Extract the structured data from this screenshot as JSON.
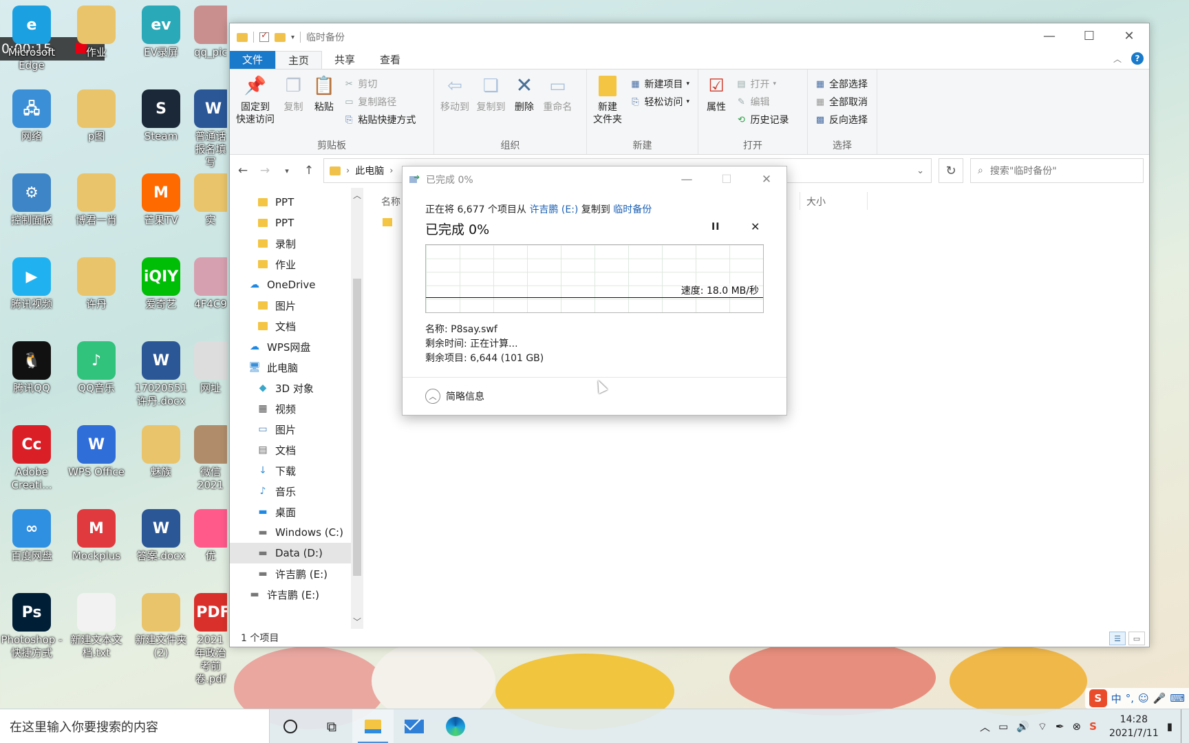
{
  "recorder": {
    "timer": "0:00:15"
  },
  "desktop": {
    "icons": [
      {
        "label": "Microsoft Edge",
        "icon": "edge-icon",
        "color": "#1ba1e2",
        "glyph": "e"
      },
      {
        "label": "作业",
        "icon": "folder-icon",
        "color": "#e9c46a",
        "glyph": ""
      },
      {
        "label": "EV录屏",
        "icon": "ev-recorder-icon",
        "color": "#2aa9b8",
        "glyph": "ev"
      },
      {
        "label": "qq_pic",
        "icon": "image-icon",
        "color": "#c98e8e",
        "glyph": ""
      },
      {
        "label": "网络",
        "icon": "network-icon",
        "color": "#3b8fd6",
        "glyph": "🖧"
      },
      {
        "label": "p图",
        "icon": "folder-icon",
        "color": "#e9c46a",
        "glyph": ""
      },
      {
        "label": "Steam",
        "icon": "steam-icon",
        "color": "#1b2838",
        "glyph": "S"
      },
      {
        "label": "普通话报名填写",
        "icon": "word-doc-icon",
        "color": "#2b5797",
        "glyph": "W"
      },
      {
        "label": "控制面板",
        "icon": "control-panel-icon",
        "color": "#3d85c6",
        "glyph": "⚙"
      },
      {
        "label": "博君一肖",
        "icon": "folder-icon",
        "color": "#e9c46a",
        "glyph": ""
      },
      {
        "label": "芒果TV",
        "icon": "mango-tv-icon",
        "color": "#ff6a00",
        "glyph": "M"
      },
      {
        "label": "实",
        "icon": "folder-icon",
        "color": "#e9c46a",
        "glyph": ""
      },
      {
        "label": "腾讯视频",
        "icon": "tencent-video-icon",
        "color": "#20b2f0",
        "glyph": "▶"
      },
      {
        "label": "许丹",
        "icon": "folder-icon",
        "color": "#e9c46a",
        "glyph": ""
      },
      {
        "label": "爱奇艺",
        "icon": "iqiyi-icon",
        "color": "#00be06",
        "glyph": "iQIY"
      },
      {
        "label": "4F4C9",
        "icon": "image-icon",
        "color": "#d7a0b0",
        "glyph": ""
      },
      {
        "label": "腾讯QQ",
        "icon": "qq-icon",
        "color": "#111111",
        "glyph": "🐧"
      },
      {
        "label": "QQ音乐",
        "icon": "qq-music-icon",
        "color": "#31c27c",
        "glyph": "♪"
      },
      {
        "label": "17020551 许丹.docx",
        "icon": "word-doc-icon",
        "color": "#2b5797",
        "glyph": "W"
      },
      {
        "label": "网址",
        "icon": "document-icon",
        "color": "#dddddd",
        "glyph": ""
      },
      {
        "label": "Adobe Creati...",
        "icon": "adobe-cc-icon",
        "color": "#da1f26",
        "glyph": "Cc"
      },
      {
        "label": "WPS Office",
        "icon": "wps-office-icon",
        "color": "#2f6dd9",
        "glyph": "W"
      },
      {
        "label": "魅族",
        "icon": "folder-icon",
        "color": "#e9c46a",
        "glyph": ""
      },
      {
        "label": "微信 2021",
        "icon": "image-icon",
        "color": "#b08c6a",
        "glyph": ""
      },
      {
        "label": "百度网盘",
        "icon": "baidu-netdisk-icon",
        "color": "#2f8fe0",
        "glyph": "∞"
      },
      {
        "label": "Mockplus",
        "icon": "mockplus-icon",
        "color": "#e0393e",
        "glyph": "M"
      },
      {
        "label": "答案.docx",
        "icon": "word-doc-icon",
        "color": "#2b5797",
        "glyph": "W"
      },
      {
        "label": "优",
        "icon": "app-icon",
        "color": "#ff5a8a",
        "glyph": ""
      },
      {
        "label": "Photoshop - 快捷方式",
        "icon": "photoshop-icon",
        "color": "#001e36",
        "glyph": "Ps"
      },
      {
        "label": "新建文本文档.txt",
        "icon": "text-file-icon",
        "color": "#f2f2f2",
        "glyph": ""
      },
      {
        "label": "新建文件夹 (2)",
        "icon": "folder-icon",
        "color": "#e9c46a",
        "glyph": ""
      },
      {
        "label": "2021年政治 考前卷.pdf",
        "icon": "pdf-icon",
        "color": "#d9302b",
        "glyph": "PDF"
      }
    ]
  },
  "explorer": {
    "title": "临时备份",
    "controls": {
      "minimize": "—",
      "maximize": "☐",
      "close": "✕"
    },
    "tabs": {
      "file": "文件",
      "home": "主页",
      "share": "共享",
      "view": "查看"
    },
    "ribbon": {
      "clipboard": {
        "title": "剪贴板",
        "pin": "固定到\n快速访问",
        "copy": "复制",
        "paste": "粘贴",
        "cut": "剪切",
        "copy_path": "复制路径",
        "paste_shortcut": "粘贴快捷方式"
      },
      "organize": {
        "title": "组织",
        "move_to": "移动到",
        "copy_to": "复制到",
        "delete": "删除",
        "rename": "重命名"
      },
      "new": {
        "title": "新建",
        "new_folder": "新建\n文件夹",
        "new_item": "新建项目",
        "easy_access": "轻松访问"
      },
      "open": {
        "title": "打开",
        "properties": "属性",
        "open": "打开",
        "edit": "编辑",
        "history": "历史记录"
      },
      "select": {
        "title": "选择",
        "select_all": "全部选择",
        "select_none": "全部取消",
        "invert": "反向选择"
      }
    },
    "address": {
      "crumb": "此电脑",
      "search_placeholder": "搜索\"临时备份\""
    },
    "nav": [
      {
        "label": "PPT",
        "type": "folder",
        "indent": 1
      },
      {
        "label": "PPT",
        "type": "folder",
        "indent": 1
      },
      {
        "label": "录制",
        "type": "folder",
        "indent": 1
      },
      {
        "label": "作业",
        "type": "folder",
        "indent": 1
      },
      {
        "label": "OneDrive",
        "type": "cloud",
        "indent": 0
      },
      {
        "label": "图片",
        "type": "folder",
        "indent": 1
      },
      {
        "label": "文档",
        "type": "folder",
        "indent": 1
      },
      {
        "label": "WPS网盘",
        "type": "cloud",
        "indent": 0
      },
      {
        "label": "此电脑",
        "type": "pc",
        "indent": 0
      },
      {
        "label": "3D 对象",
        "type": "3d",
        "indent": 1
      },
      {
        "label": "视频",
        "type": "video",
        "indent": 1
      },
      {
        "label": "图片",
        "type": "pictures",
        "indent": 1
      },
      {
        "label": "文档",
        "type": "docs",
        "indent": 1
      },
      {
        "label": "下载",
        "type": "download",
        "indent": 1
      },
      {
        "label": "音乐",
        "type": "music",
        "indent": 1
      },
      {
        "label": "桌面",
        "type": "desktop",
        "indent": 1
      },
      {
        "label": "Windows (C:)",
        "type": "drive",
        "indent": 1
      },
      {
        "label": "Data (D:)",
        "type": "drive",
        "indent": 1,
        "selected": true
      },
      {
        "label": "许吉鹏 (E:)",
        "type": "drive",
        "indent": 1
      },
      {
        "label": "许吉鹏 (E:)",
        "type": "drive",
        "indent": 0
      }
    ],
    "columns": {
      "name": "名称",
      "size": "大小"
    },
    "status": "1 个项目"
  },
  "copy_dialog": {
    "title": "已完成 0%",
    "line_prefix": "正在将 6,677 个项目从 ",
    "source": "许吉鹏 (E:)",
    "line_middle": " 复制到 ",
    "destination": "临时备份",
    "progress_heading": "已完成 0%",
    "pause": "II",
    "cancel": "✕",
    "speed": "速度: 18.0 MB/秒",
    "progress_fraction": 0.0,
    "name_line": "名称:  P8say.swf",
    "time_line": "剩余时间:  正在计算...",
    "items_line": "剩余项目:  6,644 (101 GB)",
    "less_details": "简略信息"
  },
  "taskbar": {
    "search_placeholder": "在这里输入你要搜索的内容",
    "time": "14:28",
    "date": "2021/7/11",
    "ime_label": "中"
  },
  "colors": {
    "accent": "#1979ca",
    "link": "#1a5fb4",
    "folder": "#f4c542"
  }
}
